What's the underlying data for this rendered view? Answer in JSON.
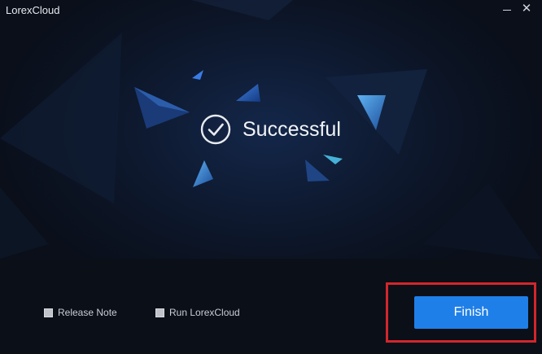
{
  "window": {
    "title": "LorexCloud",
    "minimize_symbol": "",
    "close_symbol": "✕"
  },
  "status": {
    "icon": "check-circle-icon",
    "text": "Successful"
  },
  "options": [
    {
      "label": "Release Note"
    },
    {
      "label": "Run LorexCloud"
    }
  ],
  "actions": {
    "finish_label": "Finish"
  },
  "colors": {
    "accent": "#1f7fe8",
    "highlight": "#d2262c",
    "background": "#0a0f1a"
  }
}
